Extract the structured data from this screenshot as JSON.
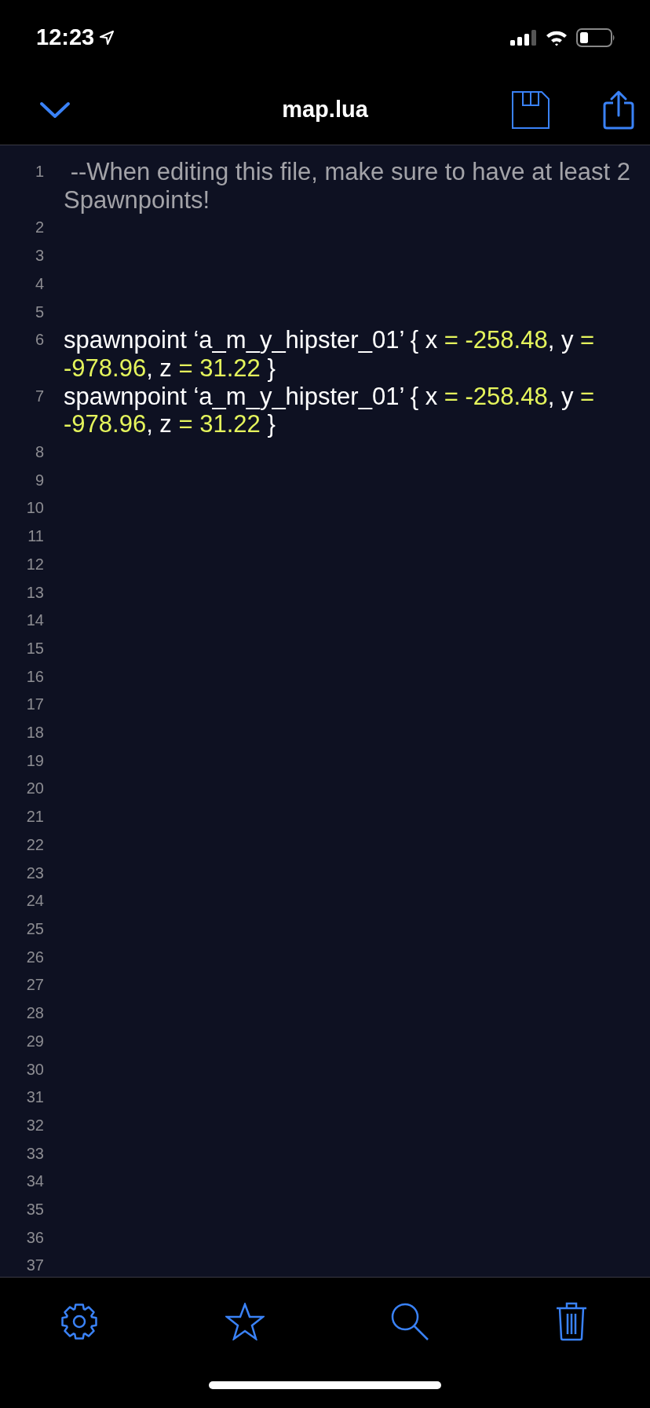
{
  "status_bar": {
    "time": "12:23"
  },
  "nav_bar": {
    "title": "map.lua"
  },
  "editor": {
    "lines": [
      {
        "number": "1",
        "tokens": [
          {
            "kind": "comment",
            "text": " --When editing this file, make sure to have at least 2 Spawnpoints!"
          }
        ]
      },
      {
        "number": "2"
      },
      {
        "number": "3"
      },
      {
        "number": "4"
      },
      {
        "number": "5"
      },
      {
        "number": "6",
        "tokens": [
          {
            "kind": "plain",
            "text": "spawnpoint ‘a_m_y_hipster_01’ { x "
          },
          {
            "kind": "number",
            "text": "= -258.48"
          },
          {
            "kind": "plain",
            "text": ", y "
          },
          {
            "kind": "number",
            "text": "= -978.96"
          },
          {
            "kind": "plain",
            "text": ", z "
          },
          {
            "kind": "number",
            "text": "= 31.22"
          },
          {
            "kind": "plain",
            "text": " }"
          }
        ]
      },
      {
        "number": "7",
        "tokens": [
          {
            "kind": "plain",
            "text": "spawnpoint ‘a_m_y_hipster_01’ { x "
          },
          {
            "kind": "number",
            "text": "= -258.48"
          },
          {
            "kind": "plain",
            "text": ", y "
          },
          {
            "kind": "number",
            "text": "= -978.96"
          },
          {
            "kind": "plain",
            "text": ", z "
          },
          {
            "kind": "number",
            "text": "= 31.22"
          },
          {
            "kind": "plain",
            "text": " }"
          }
        ]
      },
      {
        "number": "8"
      },
      {
        "number": "9"
      },
      {
        "number": "10"
      },
      {
        "number": "11"
      },
      {
        "number": "12"
      },
      {
        "number": "13"
      },
      {
        "number": "14"
      },
      {
        "number": "15"
      },
      {
        "number": "16"
      },
      {
        "number": "17"
      },
      {
        "number": "18"
      },
      {
        "number": "19"
      },
      {
        "number": "20"
      },
      {
        "number": "21"
      },
      {
        "number": "22"
      },
      {
        "number": "23"
      },
      {
        "number": "24"
      },
      {
        "number": "25"
      },
      {
        "number": "26"
      },
      {
        "number": "27"
      },
      {
        "number": "28"
      },
      {
        "number": "29"
      },
      {
        "number": "30"
      },
      {
        "number": "31"
      },
      {
        "number": "32"
      },
      {
        "number": "33"
      },
      {
        "number": "34"
      },
      {
        "number": "35"
      },
      {
        "number": "36"
      },
      {
        "number": "37"
      }
    ]
  }
}
